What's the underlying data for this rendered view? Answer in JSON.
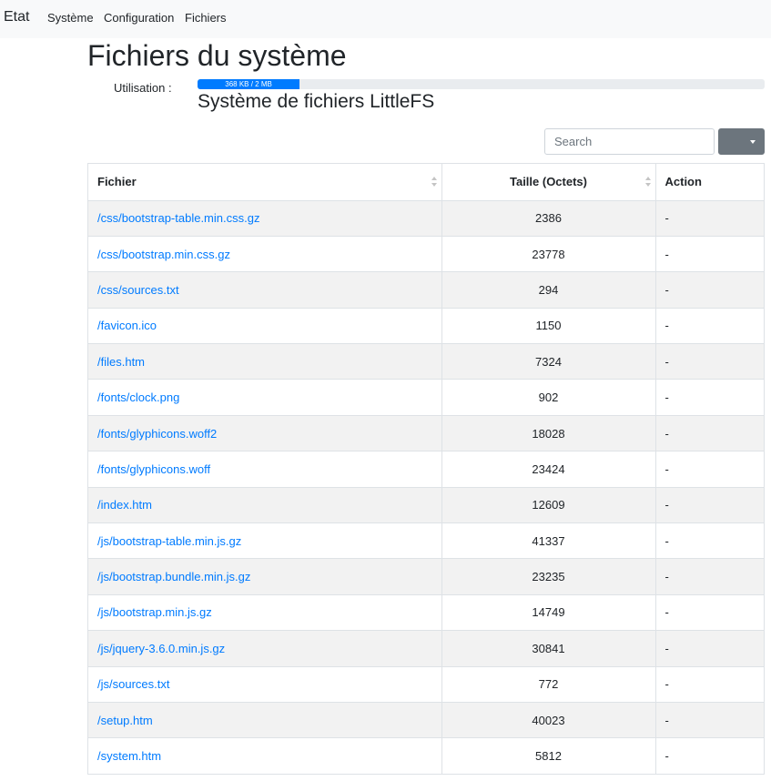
{
  "navbar": {
    "brand": "Etat",
    "links": [
      "Système",
      "Configuration",
      "Fichiers"
    ]
  },
  "page": {
    "title": "Fichiers du système",
    "usage_label": "Utilisation :",
    "usage_text": "368 KB / 2 MB",
    "usage_fraction": 0.18,
    "fs_title": "Système de fichiers LittleFS"
  },
  "toolbar": {
    "search_placeholder": "Search",
    "dropdown_icon": "caret-down-icon"
  },
  "table": {
    "columns": [
      "Fichier",
      "Taille (Octets)",
      "Action"
    ],
    "rows": [
      {
        "file": "/css/bootstrap-table.min.css.gz",
        "size": "2386",
        "action": "-"
      },
      {
        "file": "/css/bootstrap.min.css.gz",
        "size": "23778",
        "action": "-"
      },
      {
        "file": "/css/sources.txt",
        "size": "294",
        "action": "-"
      },
      {
        "file": "/favicon.ico",
        "size": "1150",
        "action": "-"
      },
      {
        "file": "/files.htm",
        "size": "7324",
        "action": "-"
      },
      {
        "file": "/fonts/clock.png",
        "size": "902",
        "action": "-"
      },
      {
        "file": "/fonts/glyphicons.woff2",
        "size": "18028",
        "action": "-"
      },
      {
        "file": "/fonts/glyphicons.woff",
        "size": "23424",
        "action": "-"
      },
      {
        "file": "/index.htm",
        "size": "12609",
        "action": "-"
      },
      {
        "file": "/js/bootstrap-table.min.js.gz",
        "size": "41337",
        "action": "-"
      },
      {
        "file": "/js/bootstrap.bundle.min.js.gz",
        "size": "23235",
        "action": "-"
      },
      {
        "file": "/js/bootstrap.min.js.gz",
        "size": "14749",
        "action": "-"
      },
      {
        "file": "/js/jquery-3.6.0.min.js.gz",
        "size": "30841",
        "action": "-"
      },
      {
        "file": "/js/sources.txt",
        "size": "772",
        "action": "-"
      },
      {
        "file": "/setup.htm",
        "size": "40023",
        "action": "-"
      },
      {
        "file": "/system.htm",
        "size": "5812",
        "action": "-"
      }
    ]
  },
  "colors": {
    "navbar_bg": "#f8f9fa",
    "link": "#007bff",
    "progress_bar": "#007bff",
    "progress_track": "#e9ecef",
    "dropdown_button": "#6c757d",
    "striped_row": "#f2f2f2"
  }
}
